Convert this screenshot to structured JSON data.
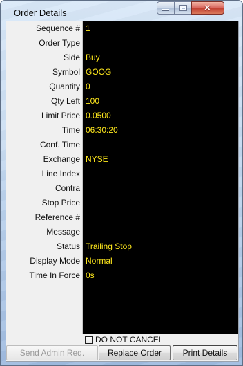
{
  "window": {
    "title": "Order Details",
    "controls": {
      "minimize": "minimize-icon",
      "maximize": "maximize-icon",
      "close": "×"
    }
  },
  "details": {
    "rows": [
      {
        "label": "Sequence #",
        "value": "1"
      },
      {
        "label": "Order Type",
        "value": ""
      },
      {
        "label": "Side",
        "value": "Buy"
      },
      {
        "label": "Symbol",
        "value": "GOOG"
      },
      {
        "label": "Quantity",
        "value": "0"
      },
      {
        "label": "Qty Left",
        "value": "100"
      },
      {
        "label": "Limit Price",
        "value": "0.0500"
      },
      {
        "label": "Time",
        "value": "06:30:20"
      },
      {
        "label": "Conf. Time",
        "value": ""
      },
      {
        "label": "Exchange",
        "value": "NYSE"
      },
      {
        "label": "Line Index",
        "value": ""
      },
      {
        "label": "Contra",
        "value": ""
      },
      {
        "label": "Stop Price",
        "value": ""
      },
      {
        "label": "Reference #",
        "value": ""
      },
      {
        "label": "Message",
        "value": ""
      },
      {
        "label": "Status",
        "value": "Trailing Stop"
      },
      {
        "label": "Display Mode",
        "value": "Normal"
      },
      {
        "label": "Time In Force",
        "value": "0s"
      }
    ]
  },
  "controls": {
    "do_not_cancel": "DO NOT CANCEL",
    "send_admin_req": "Send Admin Req.",
    "replace_order": "Replace Order",
    "print_details": "Print Details"
  },
  "colors": {
    "value_text": "#ffe81c",
    "panel_background": "#000000",
    "label_background": "#f0f0f0",
    "close_button": "#c13f31"
  },
  "icons": {
    "minimize": "minimize-icon",
    "maximize": "maximize-icon",
    "close": "close-icon",
    "checkbox": "checkbox-icon"
  }
}
